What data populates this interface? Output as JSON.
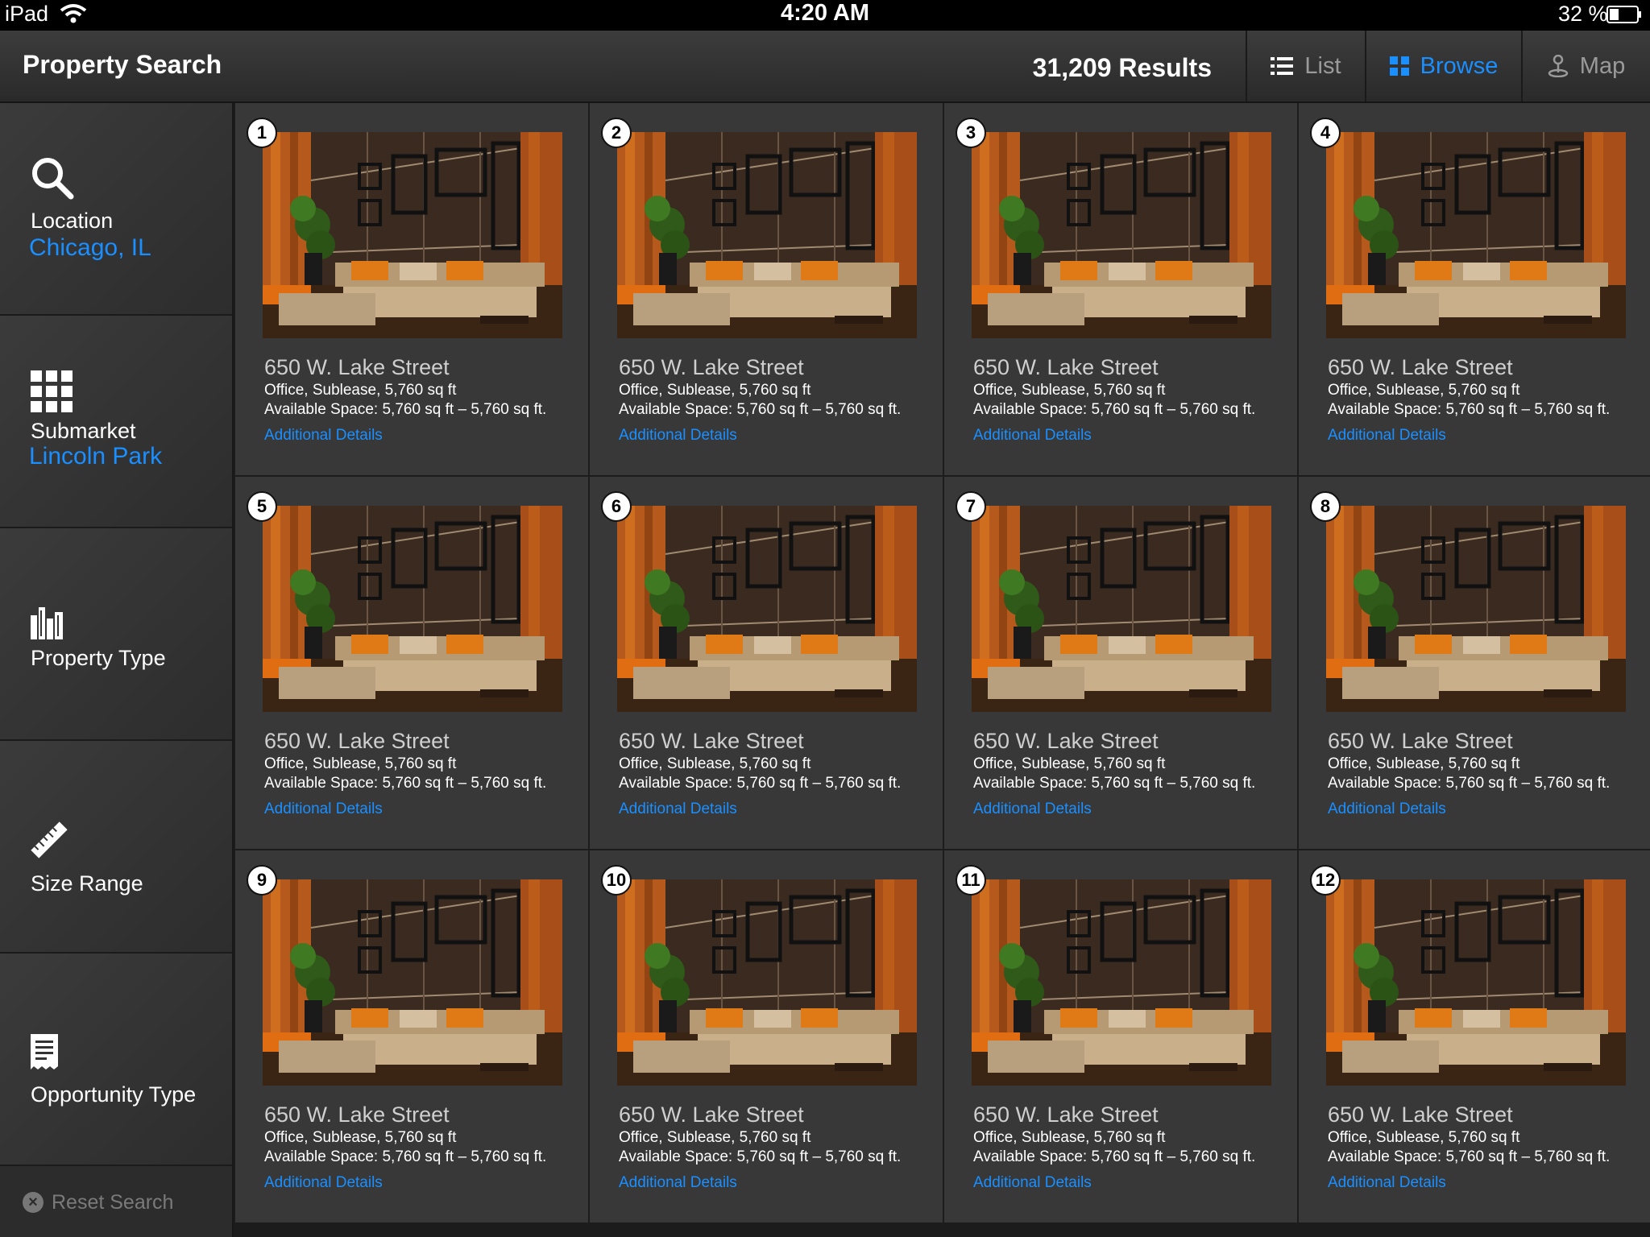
{
  "status_bar": {
    "device": "iPad",
    "time": "4:20 AM",
    "battery": "32 %"
  },
  "header": {
    "title": "Property Search",
    "results": "31,209 Results",
    "views": [
      {
        "label": "List",
        "icon": "list-icon",
        "active": false
      },
      {
        "label": "Browse",
        "icon": "grid-icon",
        "active": true
      },
      {
        "label": "Map",
        "icon": "map-pin-icon",
        "active": false
      }
    ]
  },
  "sidebar": {
    "filters": [
      {
        "label": "Location",
        "value": "Chicago, IL",
        "icon": "search-icon"
      },
      {
        "label": "Submarket",
        "value": "Lincoln Park",
        "icon": "grid-icon"
      },
      {
        "label": "Property Type",
        "value": "",
        "icon": "buildings-icon"
      },
      {
        "label": "Size Range",
        "value": "",
        "icon": "ruler-icon"
      },
      {
        "label": "Opportunity Type",
        "value": "",
        "icon": "document-icon"
      }
    ],
    "reset_label": "Reset Search"
  },
  "listings": [
    {
      "number": "1",
      "address": "650 W. Lake Street",
      "summary": "Office, Sublease, 5,760 sq ft",
      "available": "Available Space: 5,760 sq ft – 5,760 sq ft.",
      "link": "Additional Details"
    },
    {
      "number": "2",
      "address": "650 W. Lake Street",
      "summary": "Office, Sublease, 5,760 sq ft",
      "available": "Available Space: 5,760 sq ft – 5,760 sq ft.",
      "link": "Additional Details"
    },
    {
      "number": "3",
      "address": "650 W. Lake Street",
      "summary": "Office, Sublease, 5,760 sq ft",
      "available": "Available Space: 5,760 sq ft – 5,760 sq ft.",
      "link": "Additional Details"
    },
    {
      "number": "4",
      "address": "650 W. Lake Street",
      "summary": "Office, Sublease, 5,760 sq ft",
      "available": "Available Space: 5,760 sq ft – 5,760 sq ft.",
      "link": "Additional Details"
    },
    {
      "number": "5",
      "address": "650 W. Lake Street",
      "summary": "Office, Sublease, 5,760 sq ft",
      "available": "Available Space: 5,760 sq ft – 5,760 sq ft.",
      "link": "Additional Details"
    },
    {
      "number": "6",
      "address": "650 W. Lake Street",
      "summary": "Office, Sublease, 5,760 sq ft",
      "available": "Available Space: 5,760 sq ft – 5,760 sq ft.",
      "link": "Additional Details"
    },
    {
      "number": "7",
      "address": "650 W. Lake Street",
      "summary": "Office, Sublease, 5,760 sq ft",
      "available": "Available Space: 5,760 sq ft – 5,760 sq ft.",
      "link": "Additional Details"
    },
    {
      "number": "8",
      "address": "650 W. Lake Street",
      "summary": "Office, Sublease, 5,760 sq ft",
      "available": "Available Space: 5,760 sq ft – 5,760 sq ft.",
      "link": "Additional Details"
    },
    {
      "number": "9",
      "address": "650 W. Lake Street",
      "summary": "Office, Sublease, 5,760 sq ft",
      "available": "Available Space: 5,760 sq ft – 5,760 sq ft.",
      "link": "Additional Details"
    },
    {
      "number": "10",
      "address": "650 W. Lake Street",
      "summary": "Office, Sublease, 5,760 sq ft",
      "available": "Available Space: 5,760 sq ft – 5,760 sq ft.",
      "link": "Additional Details"
    },
    {
      "number": "11",
      "address": "650 W. Lake Street",
      "summary": "Office, Sublease, 5,760 sq ft",
      "available": "Available Space: 5,760 sq ft – 5,760 sq ft.",
      "link": "Additional Details"
    },
    {
      "number": "12",
      "address": "650 W. Lake Street",
      "summary": "Office, Sublease, 5,760 sq ft",
      "available": "Available Space: 5,760 sq ft – 5,760 sq ft.",
      "link": "Additional Details"
    }
  ],
  "colors": {
    "accent": "#1a8fff",
    "background": "#2b2b2b",
    "card": "#383838"
  }
}
